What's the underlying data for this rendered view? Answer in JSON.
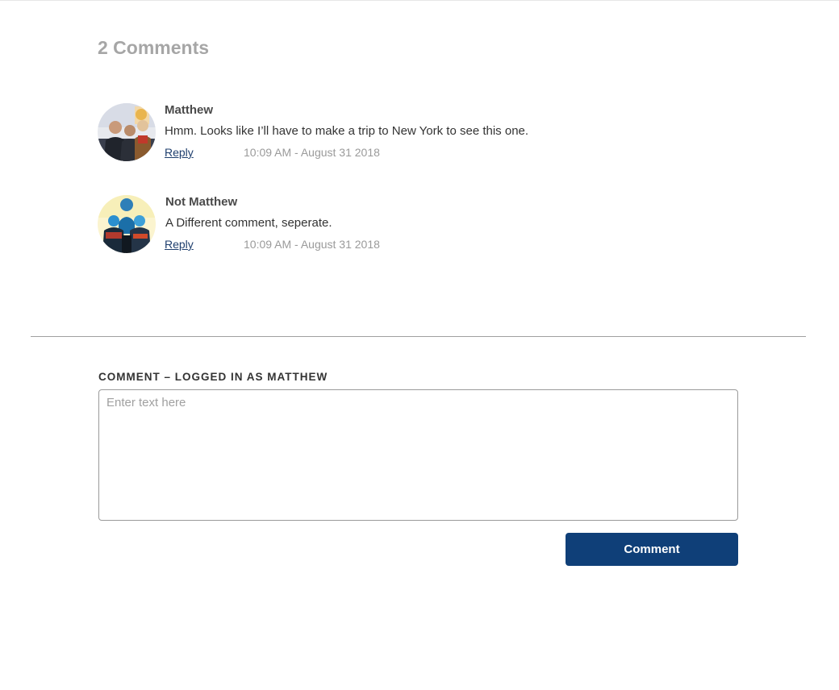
{
  "comments_section": {
    "heading": "2 Comments"
  },
  "comments": [
    {
      "author": "Matthew",
      "avatar_icon": "user-photo-avatar",
      "body": "Hmm. Looks like I’ll have to make a trip to New York to see this one.",
      "reply_label": "Reply",
      "timestamp": "10:09 AM - August 31 2018"
    },
    {
      "author": "Not Matthew",
      "avatar_icon": "user-photo-avatar",
      "body": "A Different comment, seperate.",
      "reply_label": "Reply",
      "timestamp": "10:09 AM - August 31 2018"
    }
  ],
  "comment_form": {
    "label": "COMMENT – LOGGED IN AS MATTHEW",
    "placeholder": "Enter text here",
    "value": "",
    "submit_label": "Comment"
  },
  "colors": {
    "accent": "#0f3f78",
    "link": "#1f3f6e",
    "heading_muted": "#a6a6a6",
    "timestamp": "#9a9a9a"
  }
}
